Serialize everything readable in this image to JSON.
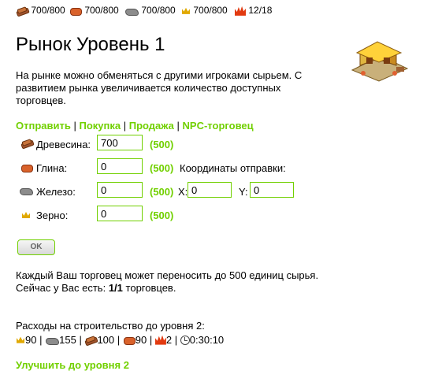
{
  "resources": [
    {
      "icon": "wood-icon",
      "value": "700/800"
    },
    {
      "icon": "clay-icon",
      "value": "700/800"
    },
    {
      "icon": "iron-icon",
      "value": "700/800"
    },
    {
      "icon": "crop-icon",
      "value": "700/800"
    },
    {
      "icon": "consumption-icon",
      "value": "12/18"
    }
  ],
  "page": {
    "title": "Рынок Уровень 1",
    "description": "На рынке можно обменяться с другими игроками сырьем. С развитием рынка увеличивается количество доступных торговцев."
  },
  "tabs": [
    "Отправить",
    "Покупка",
    "Продажа",
    "NPC-торговец"
  ],
  "tab_separator": "|",
  "form": {
    "rows": [
      {
        "icon": "wood-icon",
        "label": "Древесина:",
        "value": "700",
        "capacity": "(500)"
      },
      {
        "icon": "clay-icon",
        "label": "Глина:",
        "value": "0",
        "capacity": "(500)"
      },
      {
        "icon": "iron-icon",
        "label": "Железо:",
        "value": "0",
        "capacity": "(500)"
      },
      {
        "icon": "crop-icon",
        "label": "Зерно:",
        "value": "0",
        "capacity": "(500)"
      }
    ],
    "coords_label": "Координаты отправки:",
    "x_label": "X:",
    "x_value": "0",
    "y_label": "Y:",
    "y_value": "0",
    "ok_label": "OK"
  },
  "merchants": {
    "line1": "Каждый Ваш торговец может переносить до 500 единиц сырья.",
    "line2_prefix": "Сейчас у Вас есть:",
    "count": "1/1",
    "line2_suffix": "торговцев."
  },
  "costs": {
    "heading": "Расходы на строительство до уровня 2:",
    "items": [
      {
        "icon": "crop-icon",
        "value": "90"
      },
      {
        "icon": "iron-icon",
        "value": "155"
      },
      {
        "icon": "wood-icon",
        "value": "100"
      },
      {
        "icon": "clay-icon",
        "value": "90"
      },
      {
        "icon": "consumption-icon",
        "value": "2"
      },
      {
        "icon": "clock-icon",
        "value": "0:30:10"
      }
    ],
    "separator": "|"
  },
  "upgrade_label": "Улучшить до уровня 2",
  "colors": {
    "accent": "#71d000"
  }
}
